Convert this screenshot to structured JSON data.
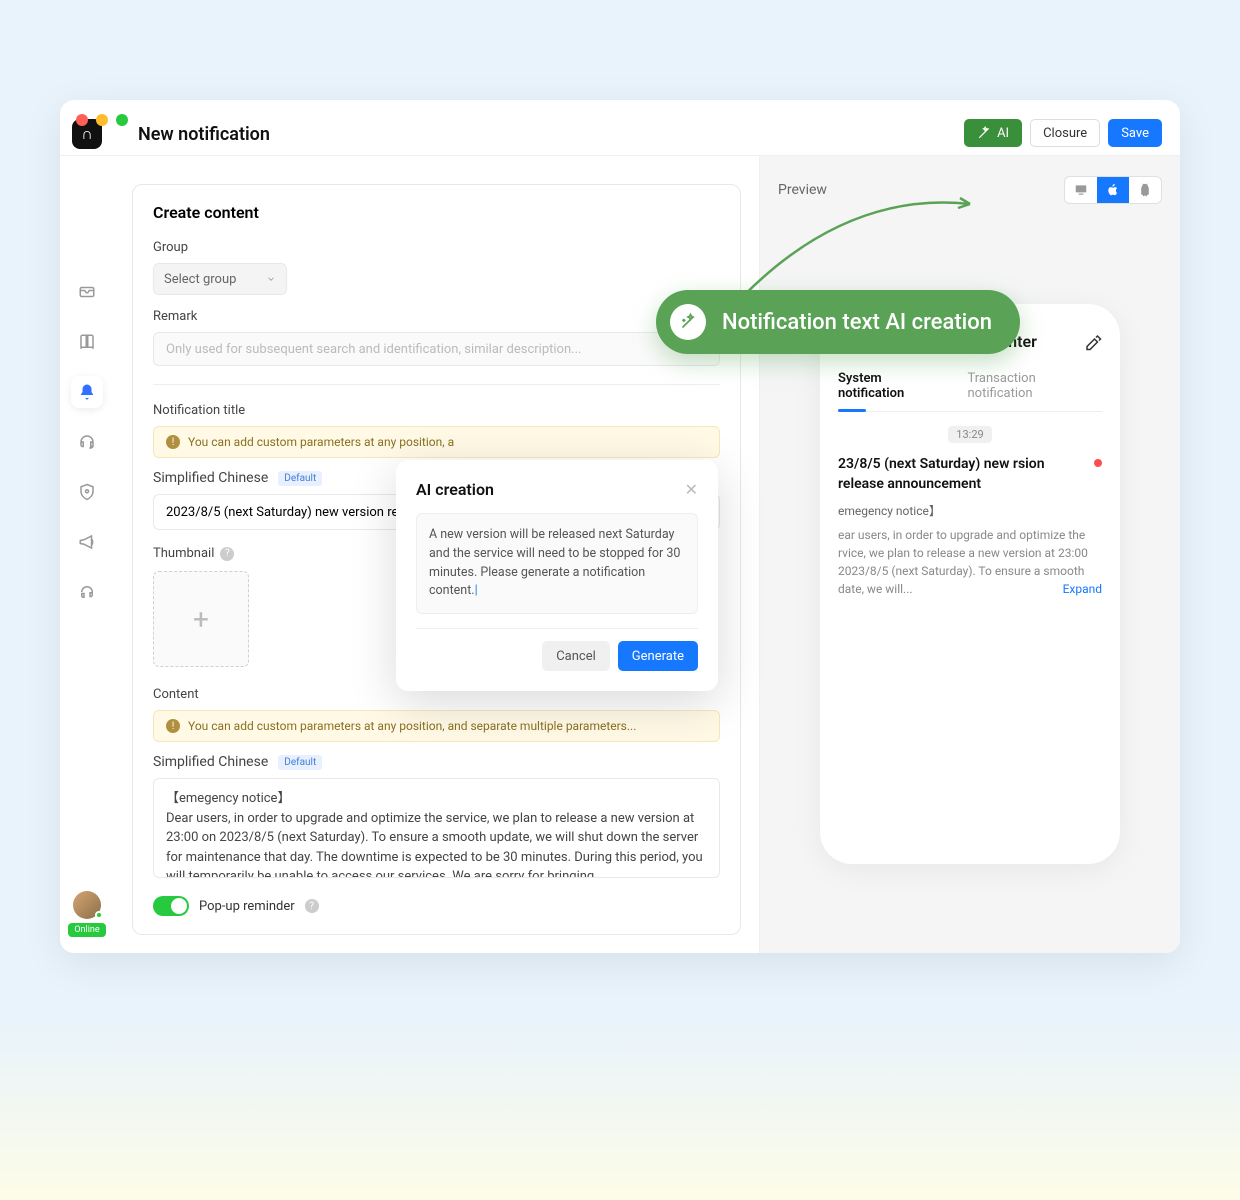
{
  "header": {
    "page_title": "New notification",
    "ai_button": "AI",
    "closure_button": "Closure",
    "save_button": "Save"
  },
  "ai_banner": {
    "text": "Notification text AI creation"
  },
  "sidenav": {
    "items": [
      {
        "name": "inbox-icon"
      },
      {
        "name": "book-icon"
      },
      {
        "name": "bell-icon"
      },
      {
        "name": "headset-icon"
      },
      {
        "name": "shield-icon"
      },
      {
        "name": "megaphone-icon"
      },
      {
        "name": "support-icon"
      }
    ],
    "status_label": "Online"
  },
  "form": {
    "card_title": "Create content",
    "group_label": "Group",
    "group_select_placeholder": "Select group",
    "remark_label": "Remark",
    "remark_placeholder": "Only used for subsequent search and identification, similar description...",
    "title_section_label": "Notification title",
    "warning_title": "You can add custom parameters at any position, a",
    "lang_label": "Simplified Chinese",
    "default_tag": "Default",
    "title_value": "2023/8/5 (next Saturday) new version relea",
    "thumbnail_label": "Thumbnail",
    "content_label": "Content",
    "warning_content": "You can add custom parameters at any position, and separate multiple parameters...",
    "content_value": "【emegency notice】\nDear users, in order to upgrade and optimize the service, we plan to release a new version at 23:00 on 2023/8/5 (next Saturday). To ensure a smooth update, we will shut down the server for maintenance that day. The downtime is expected to be 30 minutes. During this period, you will temporarily be unable to access our services. We are sorry for bringing...",
    "popup_label": "Pop-up reminder",
    "popup_enabled": true
  },
  "preview": {
    "label": "Preview",
    "nc_title": "Notification Center",
    "tabs": [
      {
        "label": "System notification",
        "active": true
      },
      {
        "label": "Transaction notification",
        "active": false
      }
    ],
    "time": "13:29",
    "notif_title": "23/8/5 (next Saturday) new rsion release announcement",
    "notif_sub": "emegency notice】",
    "notif_body": "ear users, in order to upgrade and optimize the rvice, we plan to release a new version at 23:00  2023/8/5 (next Saturday). To ensure a smooth date, we will...",
    "expand_label": "Expand"
  },
  "modal": {
    "title": "AI creation",
    "prompt": "A new version will be released next Saturday and the service will need to be stopped for 30 minutes. Please generate a notification content.",
    "cancel_label": "Cancel",
    "generate_label": "Generate"
  }
}
